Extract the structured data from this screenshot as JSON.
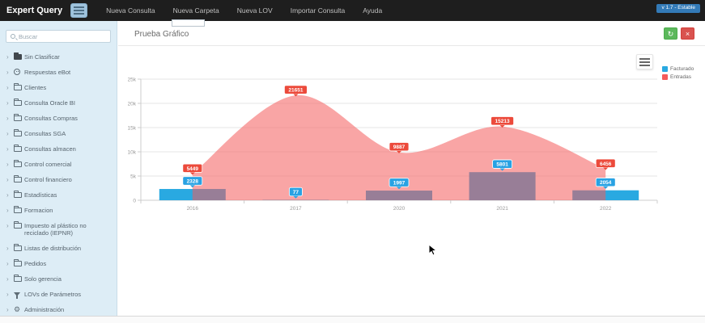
{
  "navbar": {
    "brand": "Expert Query",
    "items": [
      "Nueva Consulta",
      "Nueva Carpeta",
      "Nueva LOV",
      "Importar Consulta",
      "Ayuda"
    ],
    "version_badge": "v 1.7 - Estable"
  },
  "sidebar": {
    "search_placeholder": "Buscar",
    "items": [
      {
        "label": "Sin Clasificar",
        "icon": "folder-dark"
      },
      {
        "label": "Respuestas eBot",
        "icon": "bot"
      },
      {
        "label": "Clientes",
        "icon": "folder"
      },
      {
        "label": "Consulta Oracle BI",
        "icon": "folder"
      },
      {
        "label": "Consultas Compras",
        "icon": "folder"
      },
      {
        "label": "Consultas SGA",
        "icon": "folder"
      },
      {
        "label": "Consultas almacen",
        "icon": "folder"
      },
      {
        "label": "Control comercial",
        "icon": "folder"
      },
      {
        "label": "Control financiero",
        "icon": "folder"
      },
      {
        "label": "Estadísticas",
        "icon": "folder"
      },
      {
        "label": "Formacion",
        "icon": "folder"
      },
      {
        "label": "Impuesto al plástico no reciclado (IEPNR)",
        "icon": "folder"
      },
      {
        "label": "Listas de distribución",
        "icon": "folder"
      },
      {
        "label": "Pedidos",
        "icon": "folder"
      },
      {
        "label": "Solo gerencia",
        "icon": "folder"
      },
      {
        "label": "LOVs de Parámetros",
        "icon": "funnel"
      },
      {
        "label": "Administración",
        "icon": "gear"
      }
    ]
  },
  "content": {
    "title": "Prueba Gráfico",
    "refresh_button_icon": "↻",
    "close_button_icon": "×"
  },
  "chart_data": {
    "type": "mixed",
    "categories": [
      "2016",
      "2017",
      "2020",
      "2021",
      "2022"
    ],
    "series": [
      {
        "name": "Facturado",
        "type": "bar",
        "color": "#29a9e1",
        "label_color": "#28a2e3",
        "values": [
          2328,
          77,
          1997,
          5801,
          2054
        ]
      },
      {
        "name": "Entradas",
        "type": "area",
        "color": "#f45b5b",
        "label_color": "#ec4a3b",
        "area_opacity": 0.55,
        "values": [
          5449,
          21651,
          9887,
          15213,
          6456
        ]
      }
    ],
    "ylim": [
      0,
      25000
    ],
    "yticks": [
      {
        "value": 0,
        "label": "0"
      },
      {
        "value": 5000,
        "label": "5k"
      },
      {
        "value": 10000,
        "label": "10k"
      },
      {
        "value": 15000,
        "label": "15k"
      },
      {
        "value": 20000,
        "label": "20k"
      },
      {
        "value": 25000,
        "label": "25k"
      }
    ],
    "grid": true,
    "legend_position": "top-right"
  },
  "colors": {
    "navbar_bg": "#1e1e1e",
    "sidebar_bg": "#ddedf6",
    "accent_blue": "#337ab7",
    "button_green": "#5cb85c",
    "button_red": "#d9534f",
    "grid_line": "#e6e6e6",
    "axis_line": "#cccccc",
    "tick_text": "#999999"
  }
}
